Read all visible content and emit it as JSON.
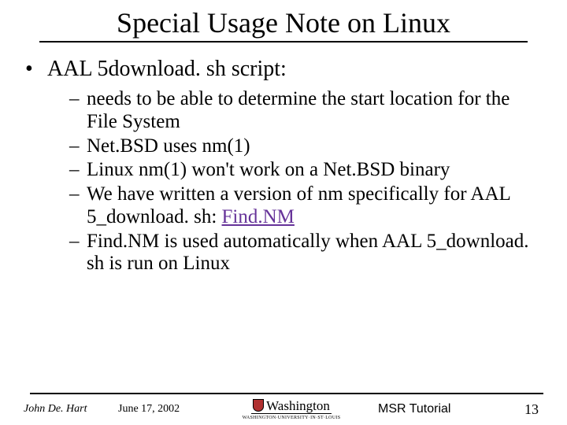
{
  "title": "Special Usage Note on Linux",
  "bullet": {
    "marker": "•",
    "text": "AAL 5download. sh script:"
  },
  "subs": [
    {
      "dash": "–",
      "pre": "needs to be able to determine the start location for the File System",
      "link": "",
      "post": ""
    },
    {
      "dash": "–",
      "pre": "Net.BSD uses nm(1)",
      "link": "",
      "post": ""
    },
    {
      "dash": "–",
      "pre": "Linux nm(1) won't work on a Net.BSD binary",
      "link": "",
      "post": ""
    },
    {
      "dash": "–",
      "pre": "We have written a version of nm specifically for AAL 5_download. sh: ",
      "link": "Find.NM",
      "post": ""
    },
    {
      "dash": "–",
      "pre": "Find.NM is used automatically when AAL 5_download. sh is run on Linux",
      "link": "",
      "post": ""
    }
  ],
  "footer": {
    "author": "John De. Hart",
    "date": "June 17,  2002",
    "university_name": "Washington",
    "university_sub": "WASHINGTON·UNIVERSITY·IN·ST·LOUIS",
    "tutorial": "MSR Tutorial",
    "page": "13"
  }
}
